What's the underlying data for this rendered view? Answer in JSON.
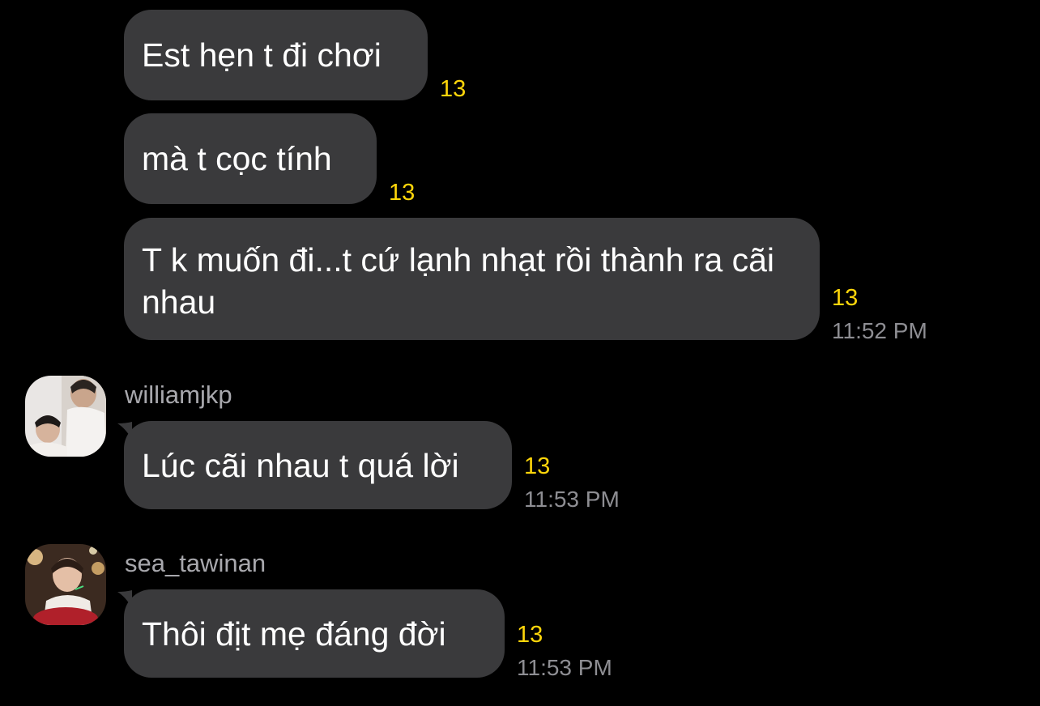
{
  "messages": [
    {
      "text": "Est hẹn t đi chơi",
      "unread": "13"
    },
    {
      "text": "mà t cọc tính",
      "unread": "13"
    },
    {
      "text": "T k muốn đi...t cứ lạnh nhạt rồi thành ra cãi nhau",
      "unread": "13",
      "time": "11:52 PM"
    },
    {
      "sender": "williamjkp",
      "avatar": "avatar-photo-icon",
      "text": "Lúc cãi nhau t quá lời",
      "unread": "13",
      "time": "11:53 PM"
    },
    {
      "sender": "sea_tawinan",
      "avatar": "avatar-photo-icon",
      "text": "Thôi địt mẹ đáng đời",
      "unread": "13",
      "time": "11:53 PM"
    }
  ],
  "colors": {
    "background": "#000000",
    "bubble": "#3a3a3c",
    "unread_count": "#ffd60a",
    "timestamp": "#8e8e93",
    "sender_name": "#a8a8ad"
  }
}
